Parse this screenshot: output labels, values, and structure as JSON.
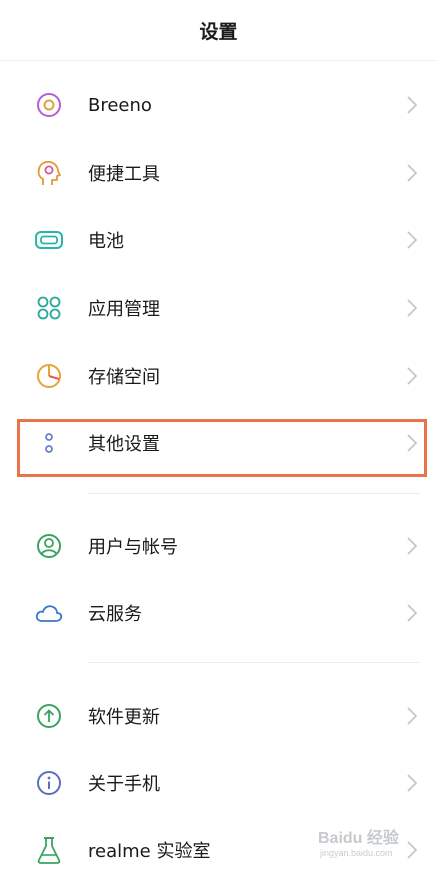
{
  "header": {
    "title": "设置"
  },
  "items": [
    {
      "label": "Breeno",
      "icon": "breeno-icon"
    },
    {
      "label": "便捷工具",
      "icon": "convenience-tools-icon"
    },
    {
      "label": "电池",
      "icon": "battery-icon"
    },
    {
      "label": "应用管理",
      "icon": "app-management-icon"
    },
    {
      "label": "存储空间",
      "icon": "storage-icon"
    },
    {
      "label": "其他设置",
      "icon": "other-settings-icon"
    },
    {
      "label": "用户与帐号",
      "icon": "user-account-icon"
    },
    {
      "label": "云服务",
      "icon": "cloud-icon"
    },
    {
      "label": "软件更新",
      "icon": "software-update-icon"
    },
    {
      "label": "关于手机",
      "icon": "about-phone-icon"
    },
    {
      "label": "realme 实验室",
      "icon": "lab-flask-icon"
    }
  ],
  "highlight": {
    "target": "其他设置",
    "color": "#e8744a"
  },
  "watermark": {
    "text": "Baidu 经验",
    "sub": "jingyan.baidu.com"
  }
}
